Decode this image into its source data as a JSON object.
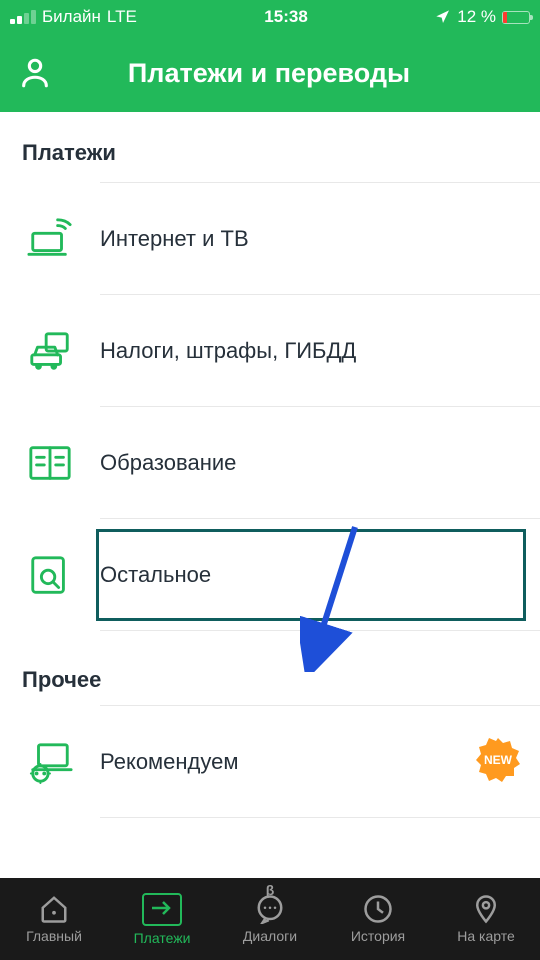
{
  "status_bar": {
    "carrier": "Билайн",
    "network": "LTE",
    "time": "15:38",
    "battery_pct": "12 %"
  },
  "header": {
    "title": "Платежи и переводы"
  },
  "sections": {
    "payments_title": "Платежи",
    "other_title": "Прочее"
  },
  "payments": {
    "items": [
      {
        "label": "Интернет и ТВ",
        "icon": "internet-tv-icon"
      },
      {
        "label": "Налоги, штрафы, ГИБДД",
        "icon": "car-fines-icon"
      },
      {
        "label": "Образование",
        "icon": "education-icon"
      },
      {
        "label": "Остальное",
        "icon": "other-search-icon",
        "highlighted": true
      }
    ]
  },
  "other": {
    "items": [
      {
        "label": "Рекомендуем",
        "icon": "recommend-icon",
        "badge": "NEW"
      }
    ]
  },
  "tabs": {
    "items": [
      {
        "label": "Главный",
        "icon": "home-icon"
      },
      {
        "label": "Платежи",
        "icon": "payments-icon",
        "active": true
      },
      {
        "label": "Диалоги",
        "icon": "chat-icon",
        "beta_mark": "β"
      },
      {
        "label": "История",
        "icon": "history-icon"
      },
      {
        "label": "На карте",
        "icon": "map-pin-icon"
      }
    ]
  },
  "colors": {
    "brand": "#22b95a",
    "text": "#26303a",
    "highlight_border": "#0f5d5d",
    "arrow": "#1e4fd8"
  }
}
